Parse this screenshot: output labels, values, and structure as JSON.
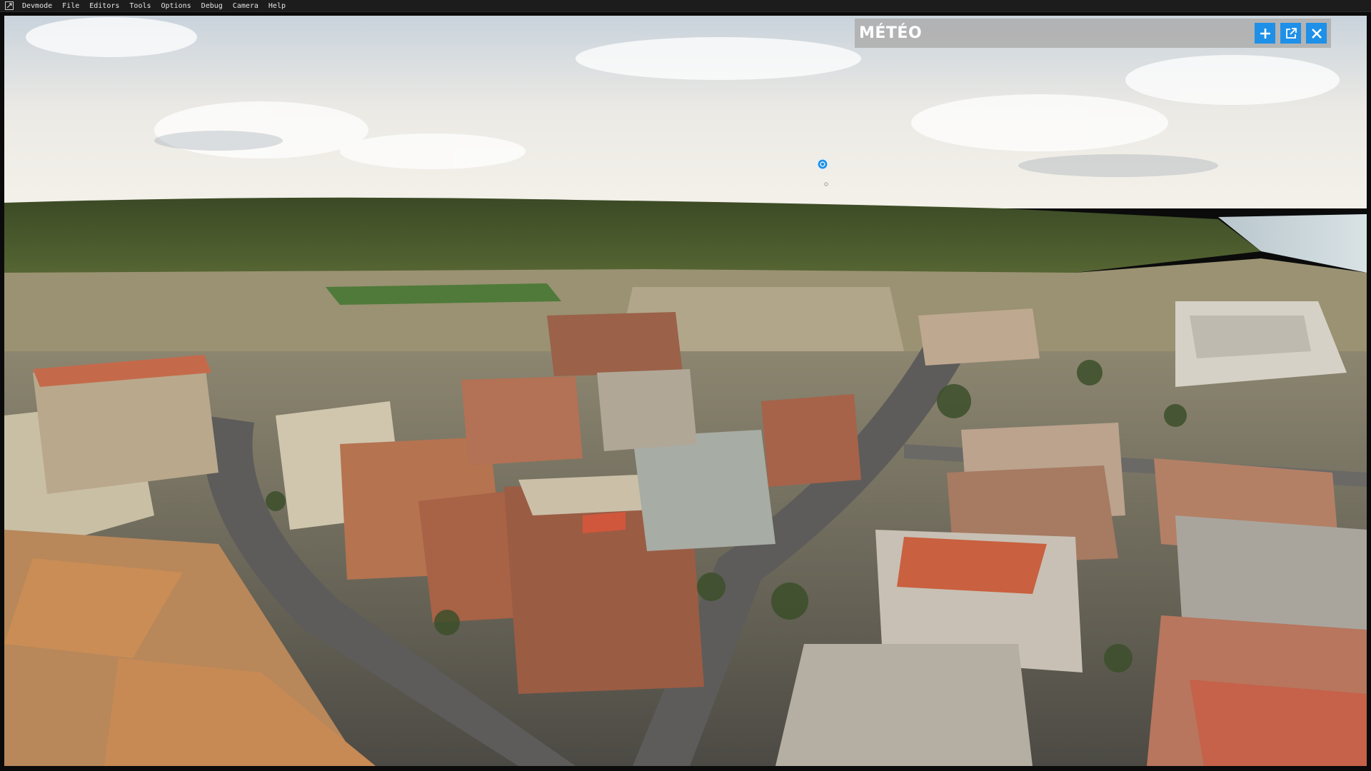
{
  "menubar": {
    "items": [
      {
        "label": "Devmode"
      },
      {
        "label": "File"
      },
      {
        "label": "Editors"
      },
      {
        "label": "Tools"
      },
      {
        "label": "Options"
      },
      {
        "label": "Debug"
      },
      {
        "label": "Camera"
      },
      {
        "label": "Help"
      }
    ]
  },
  "meteo_panel": {
    "title": "MÉTÉO",
    "buttons": [
      {
        "icon": "plus-icon"
      },
      {
        "icon": "external-link-icon"
      },
      {
        "icon": "close-icon"
      }
    ]
  },
  "colors": {
    "accent": "#1e90e8",
    "menubar_bg": "#1c1c1c",
    "panel_bg": "#afafaf"
  }
}
